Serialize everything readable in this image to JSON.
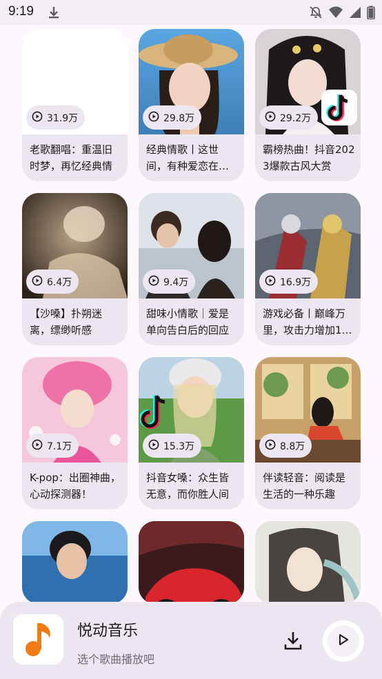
{
  "status_bar": {
    "time": "9:19",
    "icons": [
      "download-icon",
      "notifications-off-icon",
      "wifi-icon",
      "signal-icon",
      "battery-icon"
    ]
  },
  "playlists": [
    {
      "plays": "31.9万",
      "title": "老歌翻唱：重温旧时梦，再忆经典情"
    },
    {
      "plays": "29.8万",
      "title": "经典情歌丨这世间，有种爱恋在…"
    },
    {
      "plays": "29.2万",
      "title": "霸榜热曲！抖音2023爆款古风大赏"
    },
    {
      "plays": "6.4万",
      "title": "【沙嗓】扑朔迷离，缥缈听感"
    },
    {
      "plays": "9.4万",
      "title": "甜味小情歌｜爱是单向告白后的回应"
    },
    {
      "plays": "16.9万",
      "title": "游戏必备丨巅峰万里，攻击力增加1…"
    },
    {
      "plays": "7.1万",
      "title": "K-pop：出圈神曲，心动探测器！"
    },
    {
      "plays": "15.3万",
      "title": "抖音女嗓：众生皆无意，而你胜人间"
    },
    {
      "plays": "8.8万",
      "title": "伴读轻音：阅读是生活的一种乐趣"
    }
  ],
  "player": {
    "app_name": "悦动音乐",
    "subtitle": "选个歌曲播放吧"
  },
  "colors": {
    "background": "#fcf8fd",
    "card": "#ece6f0",
    "accent_orange": "#f07a16"
  }
}
